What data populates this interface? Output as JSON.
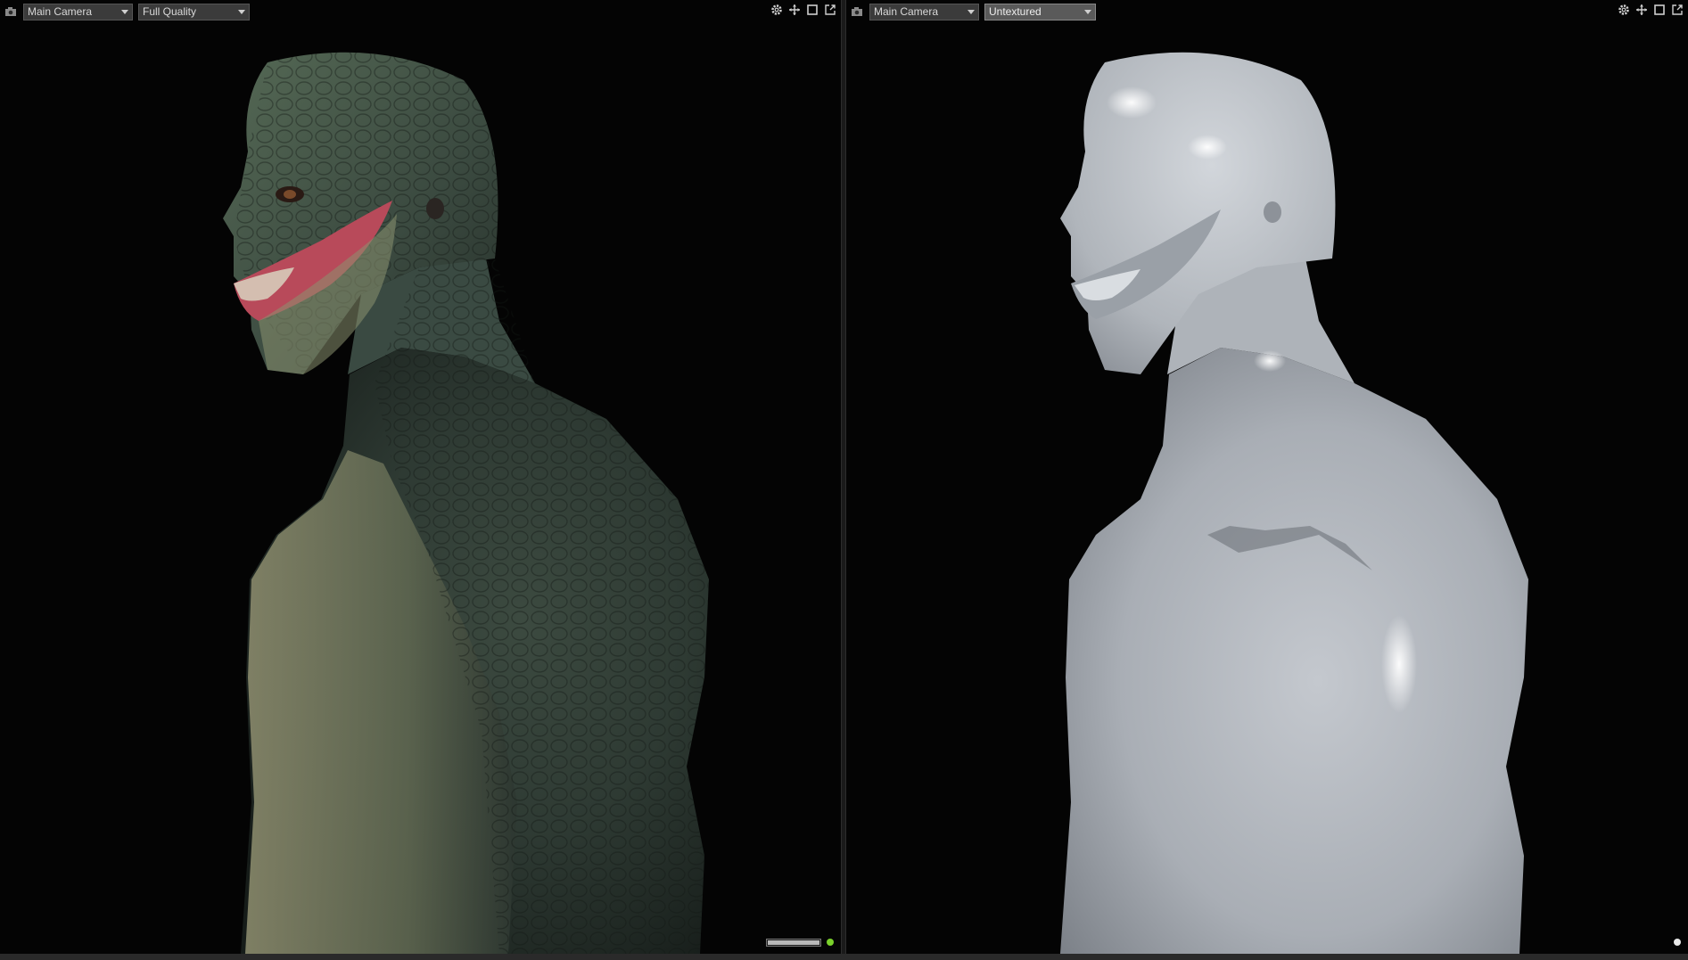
{
  "left_viewport": {
    "camera": "Main Camera",
    "render_mode": "Full Quality",
    "progress": 1.0,
    "status_color": "#7ad12b"
  },
  "right_viewport": {
    "camera": "Main Camera",
    "render_mode": "Untextured",
    "status_color": "#e8e8e8"
  },
  "icons": {
    "camera": "camera-icon",
    "settings": "gear-icon",
    "pan": "move-arrows-icon",
    "maximize": "square-maximize-icon",
    "detach": "pop-out-icon"
  },
  "colors": {
    "background": "#040404",
    "skin_textured": "#4a5a44",
    "skin_untextured": "#b9bec4"
  }
}
